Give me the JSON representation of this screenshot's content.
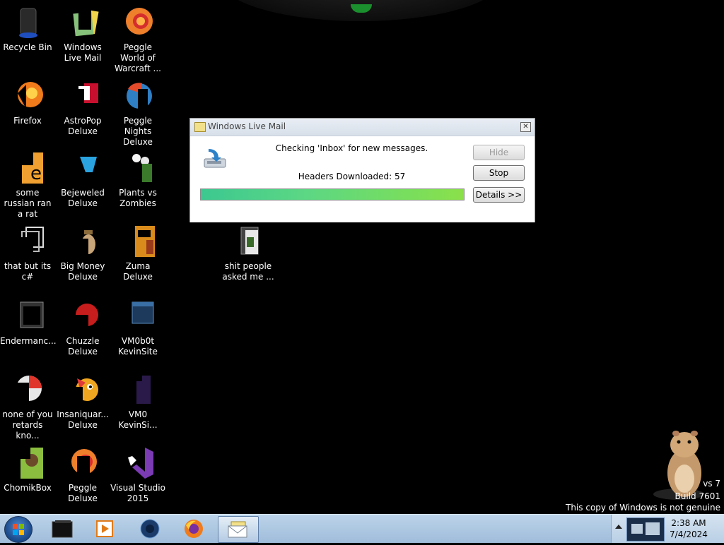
{
  "desktop": {
    "icons": [
      {
        "label": "Recycle Bin"
      },
      {
        "label": "Windows Live Mail"
      },
      {
        "label": "Peggle World of Warcraft ..."
      },
      {
        "label": "Firefox"
      },
      {
        "label": "AstroPop Deluxe"
      },
      {
        "label": "Peggle Nights Deluxe"
      },
      {
        "label": "some russian ran a rat"
      },
      {
        "label": "Bejeweled Deluxe"
      },
      {
        "label": "Plants vs Zombies"
      },
      {
        "label": "that but its c#"
      },
      {
        "label": "Big Money Deluxe"
      },
      {
        "label": "Zuma Deluxe"
      },
      {
        "label": "Endermanc..."
      },
      {
        "label": "Chuzzle Deluxe"
      },
      {
        "label": "VM0b0t KevinSite"
      },
      {
        "label": "none of you retards kno..."
      },
      {
        "label": "Insaniquar... Deluxe"
      },
      {
        "label": "VM0 KevinSi..."
      },
      {
        "label": "ChomikBox"
      },
      {
        "label": "Peggle Deluxe"
      },
      {
        "label": "Visual Studio 2015"
      },
      {
        "label": "shit people asked me ..."
      }
    ]
  },
  "dialog": {
    "title": "Windows Live Mail",
    "close_glyph": "✕",
    "status_line": "Checking 'Inbox' for new messages.",
    "headers_line": "Headers Downloaded: 57",
    "progress_percent": 100,
    "buttons": {
      "hide": "Hide",
      "stop": "Stop",
      "details": "Details >>"
    }
  },
  "watermark": {
    "line1": "vs 7",
    "line2": "Build 7601",
    "line3": "This copy of Windows is not genuine"
  },
  "taskbar": {
    "clock_time": "2:38 AM",
    "clock_date": "7/4/2024"
  },
  "colors": {
    "progress_start": "#3cc890",
    "progress_end": "#8be04a",
    "taskbar": "#9fbcda"
  }
}
